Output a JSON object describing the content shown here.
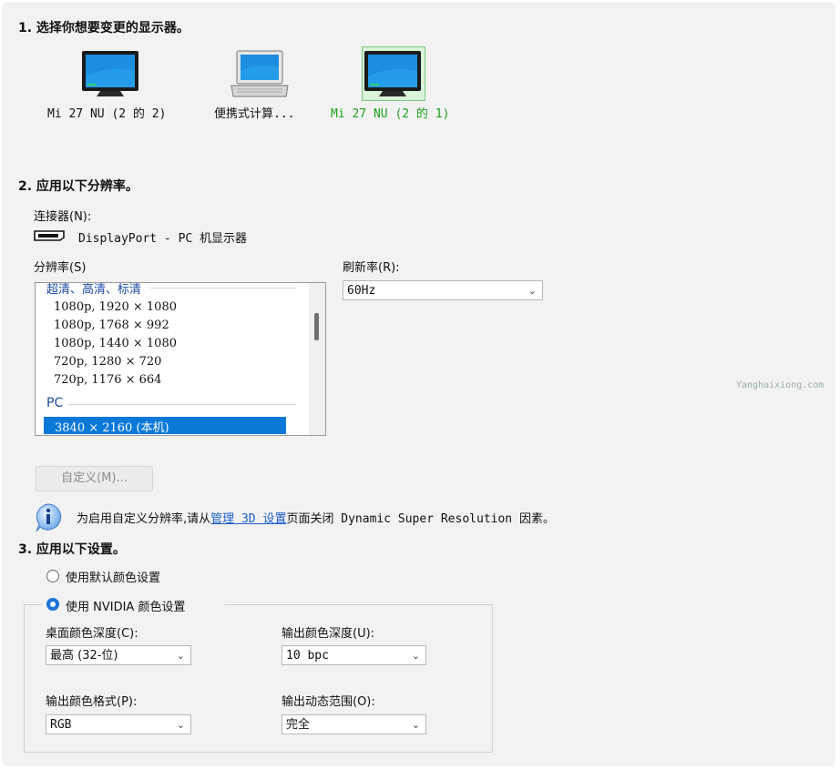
{
  "steps": {
    "s1": "1. 选择你想要变更的显示器。",
    "s2": "2. 应用以下分辨率。",
    "s3": "3. 应用以下设置。"
  },
  "monitors": [
    {
      "label": "Mi 27 NU (2 的 2)",
      "icon": "monitor-icon",
      "selected": false
    },
    {
      "label": "便携式计算...",
      "icon": "laptop-icon",
      "selected": false
    },
    {
      "label": "Mi 27 NU (2 的 1)",
      "icon": "monitor-icon",
      "selected": true
    }
  ],
  "connector": {
    "label": "连接器(N):",
    "icon": "displayport-icon",
    "value": "DisplayPort - PC 机显示器"
  },
  "resolution": {
    "label": "分辨率(S)",
    "group1": "超清、高清、标清",
    "items": [
      "1080p, 1920 × 1080",
      "1080p, 1768 × 992",
      "1080p, 1440 × 1080",
      "720p, 1280 × 720",
      "720p, 1176 × 664"
    ],
    "group2": "PC",
    "selected_item": "3840 × 2160 (本机)"
  },
  "refresh": {
    "label": "刷新率(R):",
    "value": "60Hz"
  },
  "custom_button": "自定义(M)...",
  "info": {
    "icon": "info-icon",
    "text_before": "为启用自定义分辨率,请从",
    "link": "管理 3D 设置",
    "text_after": "页面关闭 Dynamic Super Resolution 因素。"
  },
  "color": {
    "radio_default": "使用默认颜色设置",
    "radio_nvidia": "使用 NVIDIA 颜色设置",
    "selected": "nvidia",
    "desktop_depth_label": "桌面颜色深度(C):",
    "desktop_depth_value": "最高 (32-位)",
    "output_depth_label": "输出颜色深度(U):",
    "output_depth_value": "10 bpc",
    "output_format_label": "输出颜色格式(P):",
    "output_format_value": "RGB",
    "output_range_label": "输出动态范围(O):",
    "output_range_value": "完全"
  },
  "watermark": "Yanghaixiong.com",
  "colors": {
    "selected_label": "#1aa11a",
    "link": "#1a5fc9",
    "list_selection": "#0a78d7"
  }
}
